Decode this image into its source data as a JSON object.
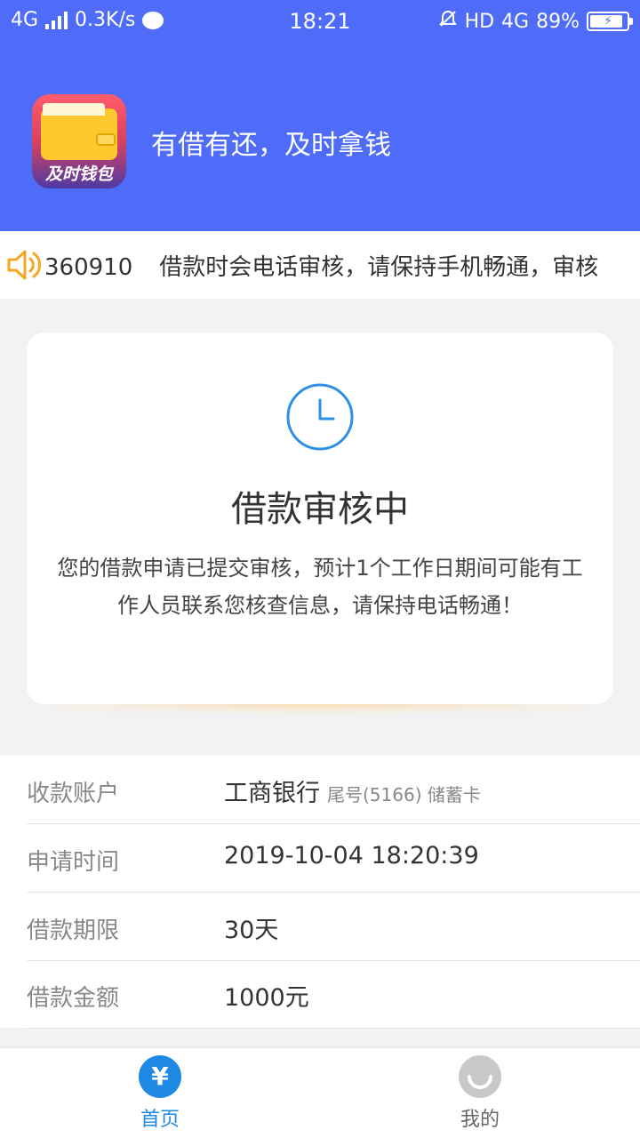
{
  "status_bar": {
    "network": "4G",
    "speed": "0.3K/s",
    "time": "18:21",
    "hd": "HD",
    "network_right": "4G",
    "battery": "89%"
  },
  "header": {
    "logo_text": "及时钱包",
    "slogan": "有借有还，及时拿钱"
  },
  "notice": {
    "number": "360910",
    "text": "借款时会电话审核，请保持手机畅通，审核"
  },
  "status_card": {
    "title": "借款审核中",
    "description": "您的借款申请已提交审核，预计1个工作日期间可能有工作人员联系您核查信息，请保持电话畅通！"
  },
  "info": {
    "rows": [
      {
        "label": "收款账户",
        "value": "工商银行",
        "sub": "尾号(5166) 储蓄卡"
      },
      {
        "label": "申请时间",
        "value": "2019-10-04 18:20:39"
      },
      {
        "label": "借款期限",
        "value": "30天"
      },
      {
        "label": "借款金额",
        "value": "1000元"
      }
    ]
  },
  "tabbar": {
    "home_icon": "¥",
    "home": "首页",
    "mine": "我的"
  },
  "colors": {
    "primary": "#4f6cf8",
    "tab_active": "#1e88e5",
    "speaker": "#f5a623"
  }
}
